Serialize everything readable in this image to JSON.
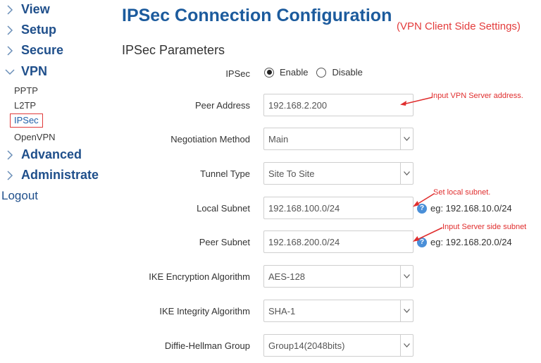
{
  "sidebar": {
    "items": [
      {
        "label": "View"
      },
      {
        "label": "Setup"
      },
      {
        "label": "Secure"
      },
      {
        "label": "VPN"
      },
      {
        "label": "Advanced"
      },
      {
        "label": "Administrate"
      }
    ],
    "vpn_subitems": [
      {
        "label": "PPTP"
      },
      {
        "label": "L2TP"
      },
      {
        "label": "IPSec"
      },
      {
        "label": "OpenVPN"
      }
    ],
    "logout": "Logout"
  },
  "page": {
    "title": "IPSec Connection Configuration",
    "subtitle": "(VPN Client Side Settings)",
    "section": "IPSec Parameters"
  },
  "form": {
    "ipsec": {
      "label": "IPSec",
      "options": [
        "Enable",
        "Disable"
      ],
      "selected": "Enable"
    },
    "peer_address": {
      "label": "Peer Address",
      "value": "192.168.2.200"
    },
    "negotiation_method": {
      "label": "Negotiation Method",
      "value": "Main"
    },
    "tunnel_type": {
      "label": "Tunnel Type",
      "value": "Site To Site"
    },
    "local_subnet": {
      "label": "Local Subnet",
      "value": "192.168.100.0/24",
      "hint": "eg: 192.168.10.0/24"
    },
    "peer_subnet": {
      "label": "Peer Subnet",
      "value": "192.168.200.0/24",
      "hint": "eg: 192.168.20.0/24"
    },
    "ike_encryption": {
      "label": "IKE Encryption Algorithm",
      "value": "AES-128"
    },
    "ike_integrity": {
      "label": "IKE Integrity Algorithm",
      "value": "SHA-1"
    },
    "dh_group": {
      "label": "Diffie-Hellman Group",
      "value": "Group14(2048bits)"
    }
  },
  "annotations": {
    "peer_address": "Input VPN Server address.",
    "local_subnet": "Set local subnet.",
    "peer_subnet": "Input Server side subnet"
  },
  "icons": {
    "help": "question-mark-icon",
    "chevron_right": "chevron-right-icon",
    "chevron_down": "chevron-down-icon"
  },
  "colors": {
    "nav_text": "#1f4f8b",
    "title": "#1c5b9d",
    "annotation": "#e02e2e",
    "active_border": "#e03a3a",
    "help_icon": "#4a8fd8"
  }
}
